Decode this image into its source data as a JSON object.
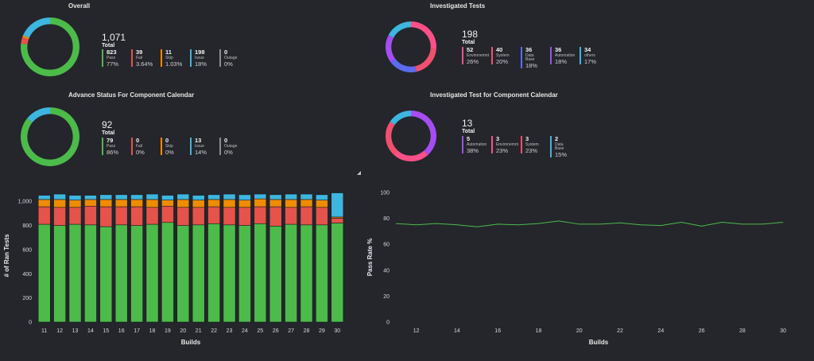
{
  "colors": {
    "pass": "#4cbb4a",
    "fail": "#e5534b",
    "skip": "#f08c00",
    "issue": "#3db6e0",
    "outage": "#8a8d93",
    "environment": "#ff4f87",
    "system": "#f0506e",
    "database": "#5b6cf0",
    "automation": "#a64cf5",
    "others": "#3db6e0"
  },
  "panels": {
    "overall": {
      "title": "Overall",
      "total": "1,071",
      "total_label": "Total",
      "donut": [
        {
          "value": 823,
          "color": "#4cbb4a"
        },
        {
          "value": 39,
          "color": "#e5534b"
        },
        {
          "value": 11,
          "color": "#f08c00"
        },
        {
          "value": 198,
          "color": "#3db6e0"
        },
        {
          "value": 0,
          "color": "#8a8d93"
        }
      ],
      "stats": [
        {
          "value": "823",
          "label": "Pass",
          "pct": "77%",
          "color": "#4cbb4a"
        },
        {
          "value": "39",
          "label": "Fail",
          "pct": "3.64%",
          "color": "#e5534b"
        },
        {
          "value": "11",
          "label": "Skip",
          "pct": "1.03%",
          "color": "#f08c00"
        },
        {
          "value": "198",
          "label": "Issue",
          "pct": "18%",
          "color": "#3db6e0"
        },
        {
          "value": "0",
          "label": "Outage",
          "pct": "0%",
          "color": "#8a8d93"
        }
      ]
    },
    "investigated": {
      "title": "Investigated Tests",
      "total": "198",
      "total_label": "Total",
      "donut": [
        {
          "value": 52,
          "color": "#ff4f87"
        },
        {
          "value": 40,
          "color": "#f0506e"
        },
        {
          "value": 36,
          "color": "#5b6cf0"
        },
        {
          "value": 36,
          "color": "#a64cf5"
        },
        {
          "value": 34,
          "color": "#3db6e0"
        }
      ],
      "stats": [
        {
          "value": "52",
          "label": "Environemnt",
          "pct": "26%",
          "color": "#ff4f87"
        },
        {
          "value": "40",
          "label": "System",
          "pct": "20%",
          "color": "#f0506e"
        },
        {
          "value": "36",
          "label": "Data Base",
          "pct": "18%",
          "color": "#5b6cf0"
        },
        {
          "value": "36",
          "label": "Automation",
          "pct": "18%",
          "color": "#a64cf5"
        },
        {
          "value": "34",
          "label": "others",
          "pct": "17%",
          "color": "#3db6e0"
        }
      ]
    },
    "advance": {
      "title": "Advance Status For Component Calendar",
      "total": "92",
      "total_label": "Total",
      "donut": [
        {
          "value": 79,
          "color": "#4cbb4a"
        },
        {
          "value": 0,
          "color": "#e5534b"
        },
        {
          "value": 0,
          "color": "#f08c00"
        },
        {
          "value": 13,
          "color": "#3db6e0"
        },
        {
          "value": 0,
          "color": "#8a8d93"
        }
      ],
      "stats": [
        {
          "value": "79",
          "label": "Pass",
          "pct": "86%",
          "color": "#4cbb4a"
        },
        {
          "value": "0",
          "label": "Fail",
          "pct": "0%",
          "color": "#e5534b"
        },
        {
          "value": "0",
          "label": "Skip",
          "pct": "0%",
          "color": "#f08c00"
        },
        {
          "value": "13",
          "label": "Issue",
          "pct": "14%",
          "color": "#3db6e0"
        },
        {
          "value": "0",
          "label": "Outage",
          "pct": "0%",
          "color": "#8a8d93"
        }
      ]
    },
    "invcal": {
      "title": "Investigated Test for Component Calendar",
      "total": "13",
      "total_label": "Total",
      "donut": [
        {
          "value": 5,
          "color": "#a64cf5"
        },
        {
          "value": 3,
          "color": "#ff4f87"
        },
        {
          "value": 3,
          "color": "#f0506e"
        },
        {
          "value": 2,
          "color": "#3db6e0"
        }
      ],
      "stats": [
        {
          "value": "5",
          "label": "Automation",
          "pct": "38%",
          "color": "#a64cf5"
        },
        {
          "value": "3",
          "label": "Environemnt",
          "pct": "23%",
          "color": "#ff4f87"
        },
        {
          "value": "3",
          "label": "System",
          "pct": "23%",
          "color": "#f0506e"
        },
        {
          "value": "2",
          "label": "Data Base",
          "pct": "15%",
          "color": "#3db6e0"
        }
      ]
    }
  },
  "chart_data": [
    {
      "type": "bar",
      "stacked": true,
      "xlabel": "Builds",
      "ylabel": "# of Ran Tests",
      "ylim": [
        0,
        1100
      ],
      "yticks": [
        0,
        200,
        400,
        600,
        800,
        "1,000"
      ],
      "categories": [
        "11",
        "12",
        "13",
        "14",
        "15",
        "16",
        "17",
        "18",
        "19",
        "20",
        "21",
        "22",
        "23",
        "24",
        "25",
        "26",
        "27",
        "28",
        "29",
        "30"
      ],
      "series": [
        {
          "values": [
            810,
            800,
            810,
            805,
            790,
            805,
            800,
            810,
            825,
            800,
            805,
            815,
            805,
            800,
            815,
            795,
            810,
            805,
            805,
            820
          ],
          "color": "#4cbb4a"
        },
        {
          "values": [
            145,
            150,
            140,
            155,
            165,
            150,
            155,
            140,
            135,
            150,
            145,
            140,
            145,
            150,
            140,
            160,
            140,
            150,
            145,
            40
          ],
          "color": "#e5534b"
        },
        {
          "values": [
            60,
            65,
            60,
            55,
            60,
            60,
            60,
            65,
            50,
            65,
            60,
            60,
            65,
            60,
            65,
            60,
            65,
            60,
            60,
            10
          ],
          "color": "#f08c00"
        },
        {
          "values": [
            35,
            45,
            40,
            35,
            40,
            40,
            40,
            45,
            40,
            45,
            40,
            40,
            45,
            45,
            40,
            40,
            45,
            45,
            45,
            200
          ],
          "color": "#3db6e0"
        }
      ]
    },
    {
      "type": "line",
      "xlabel": "Builds",
      "ylabel": "Pass Rate %",
      "ylim": [
        0,
        100
      ],
      "yticks": [
        0,
        20,
        40,
        60,
        80,
        100
      ],
      "xticks": [
        12,
        14,
        16,
        18,
        20,
        22,
        24,
        26,
        28,
        30
      ],
      "x": [
        11,
        12,
        13,
        14,
        15,
        16,
        17,
        18,
        19,
        20,
        21,
        22,
        23,
        24,
        25,
        26,
        27,
        28,
        29,
        30
      ],
      "y": [
        76,
        75,
        76,
        75,
        73.5,
        75.5,
        75,
        76,
        78,
        75.5,
        75.5,
        76.5,
        75,
        74.5,
        77,
        74,
        77,
        75.5,
        75.5,
        77
      ],
      "color": "#4cbb4a"
    }
  ]
}
